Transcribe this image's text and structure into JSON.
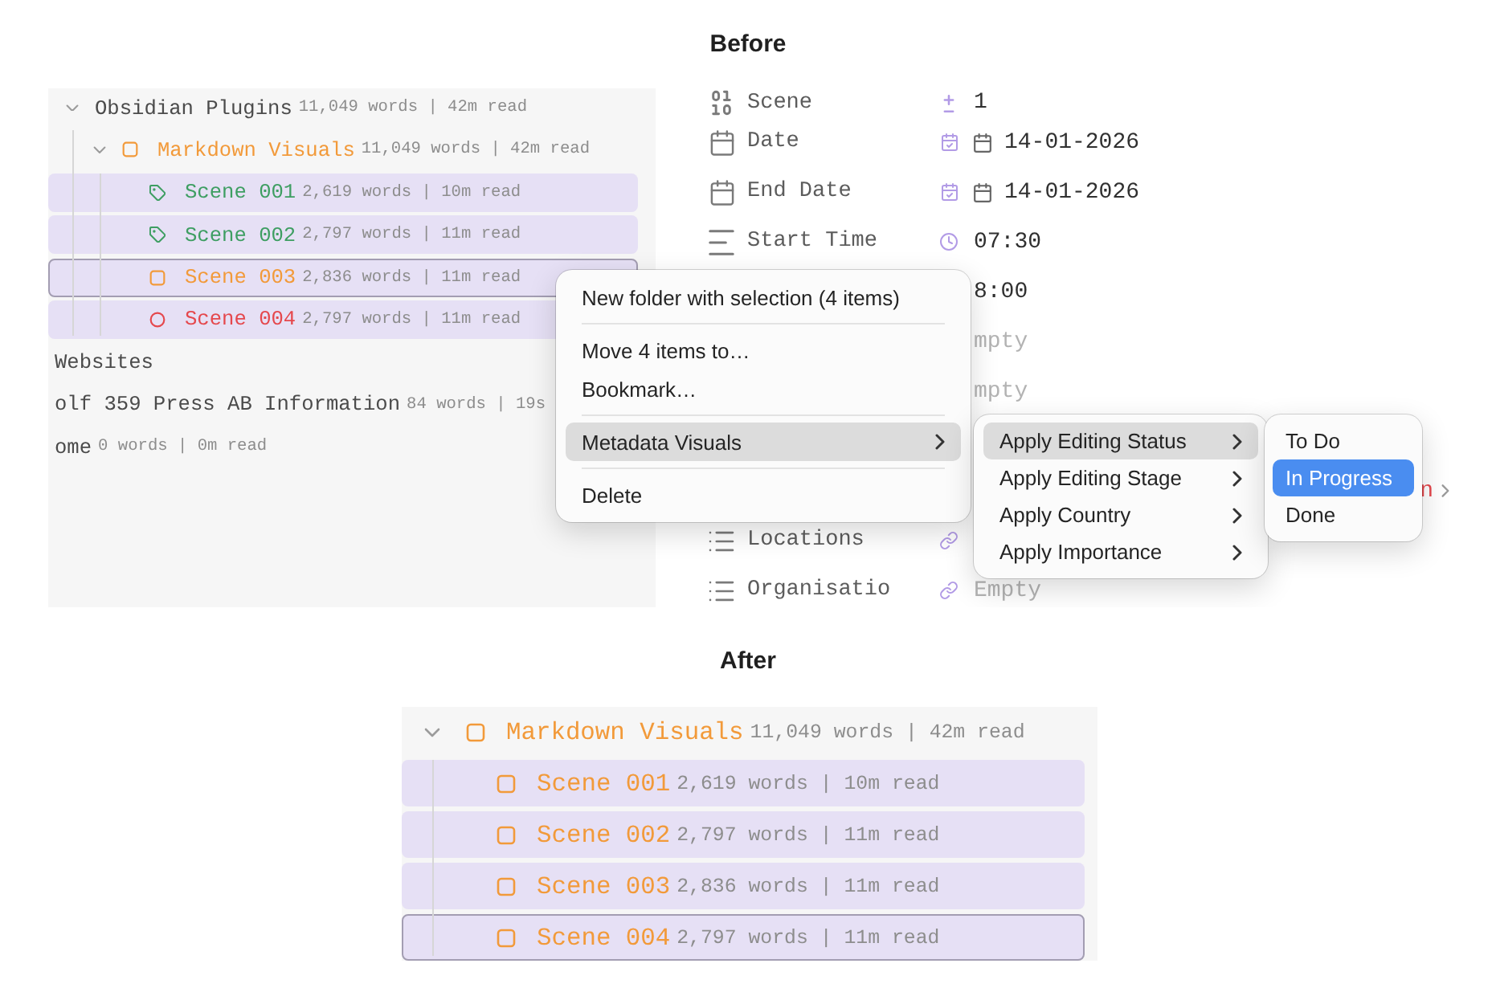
{
  "before": {
    "heading": "Before",
    "file_tree": {
      "items": [
        {
          "kind": "plain",
          "name": "Obsidian Plugins",
          "meta": "11,049 words | 42m read",
          "expanded": true,
          "selected": false,
          "focused": false,
          "children": [
            {
              "kind": "square",
              "name": "Markdown Visuals",
              "meta": "11,049 words | 42m read",
              "color": "#f29a3a",
              "expanded": true,
              "selected": false,
              "focused": false,
              "children": [
                {
                  "kind": "tag",
                  "name": "Scene 001",
                  "meta": "2,619 words | 10m read",
                  "color": "#3e9e62",
                  "selected": true,
                  "focused": false
                },
                {
                  "kind": "tag",
                  "name": "Scene 002",
                  "meta": "2,797 words | 11m read",
                  "color": "#3e9e62",
                  "selected": true,
                  "focused": false
                },
                {
                  "kind": "square",
                  "name": "Scene 003",
                  "meta": "2,836 words | 11m read",
                  "color": "#f29a3a",
                  "selected": true,
                  "focused": true
                },
                {
                  "kind": "circle",
                  "name": "Scene 004",
                  "meta": "2,797 words | 11m read",
                  "color": "#e5484d",
                  "selected": true,
                  "focused": false
                }
              ]
            }
          ]
        },
        {
          "kind": "plain",
          "name": "Websites",
          "selected": false,
          "focused": false
        },
        {
          "kind": "plain",
          "name": "olf 359 Press AB Information",
          "meta": "84 words | 19s",
          "selected": false,
          "focused": false
        },
        {
          "kind": "plain",
          "name": "ome",
          "meta": "0 words | 0m read",
          "selected": false,
          "focused": false
        }
      ]
    },
    "properties": {
      "rows": [
        {
          "kind": "number",
          "label": "Scene",
          "value": "1"
        },
        {
          "kind": "date",
          "label": "Date",
          "value": "14-01-2026"
        },
        {
          "kind": "date",
          "label": "End Date",
          "value": "14-01-2026"
        },
        {
          "kind": "time",
          "label": "Start Time",
          "value": "07:30"
        },
        {
          "value": "8:00"
        },
        {
          "placeholder": "mpty"
        },
        {
          "placeholder": "mpty"
        },
        {
          "kind": "status",
          "value": "n"
        },
        {
          "kind": "list",
          "label": "Locations"
        },
        {
          "kind": "list",
          "label": "Organisatio",
          "placeholder": "Empty"
        }
      ]
    },
    "context_menu": {
      "groups": [
        [
          {
            "label": "New folder with selection (4 items)",
            "has_submenu": false,
            "highlighted": false
          }
        ],
        [
          {
            "label": "Move 4 items to…",
            "has_submenu": false,
            "highlighted": false
          },
          {
            "label": "Bookmark…",
            "has_submenu": false,
            "highlighted": false
          }
        ],
        [
          {
            "label": "Metadata Visuals",
            "has_submenu": true,
            "highlighted": true,
            "submenu": {
              "items": [
                {
                  "label": "Apply Editing Status",
                  "has_submenu": true,
                  "highlighted": true,
                  "submenu": {
                    "items": [
                      {
                        "label": "To Do",
                        "selected": false
                      },
                      {
                        "label": "In Progress",
                        "selected": true
                      },
                      {
                        "label": "Done",
                        "selected": false
                      }
                    ]
                  }
                },
                {
                  "label": "Apply Editing Stage",
                  "has_submenu": true,
                  "highlighted": false
                },
                {
                  "label": "Apply Country",
                  "has_submenu": true,
                  "highlighted": false
                },
                {
                  "label": "Apply Importance",
                  "has_submenu": true,
                  "highlighted": false
                }
              ]
            }
          }
        ],
        [
          {
            "label": "Delete",
            "has_submenu": false,
            "highlighted": false
          }
        ]
      ]
    }
  },
  "after": {
    "heading": "After",
    "file_tree": {
      "items": [
        {
          "kind": "square",
          "name": "Markdown Visuals",
          "meta": "11,049 words | 42m read",
          "color": "#f29a3a",
          "expanded": true,
          "selected": false,
          "focused": false,
          "children": [
            {
              "kind": "square",
              "name": "Scene 001",
              "meta": "2,619 words | 10m read",
              "color": "#f29a3a",
              "selected": true,
              "focused": false
            },
            {
              "kind": "square",
              "name": "Scene 002",
              "meta": "2,797 words | 11m read",
              "color": "#f29a3a",
              "selected": true,
              "focused": false
            },
            {
              "kind": "square",
              "name": "Scene 003",
              "meta": "2,836 words | 11m read",
              "color": "#f29a3a",
              "selected": true,
              "focused": false
            },
            {
              "kind": "square",
              "name": "Scene 004",
              "meta": "2,797 words | 11m read",
              "color": "#f29a3a",
              "selected": true,
              "focused": true
            }
          ]
        }
      ]
    }
  }
}
